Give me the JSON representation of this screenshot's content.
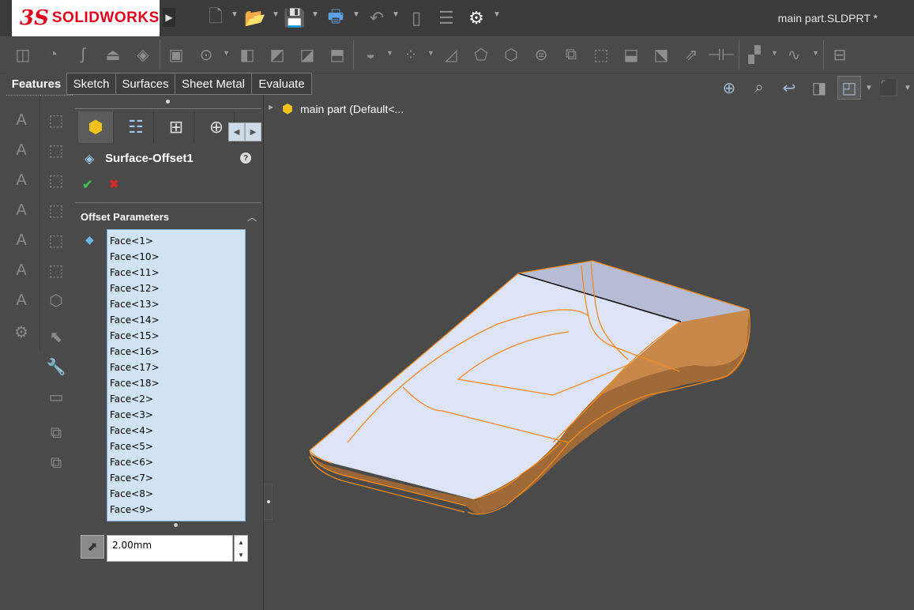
{
  "app": {
    "brand_ds": "3S",
    "brand_name": "SOLIDWORKS",
    "document_title": "main part.SLDPRT *"
  },
  "command_tabs": [
    "Features",
    "Sketch",
    "Surfaces",
    "Sheet Metal",
    "Evaluate"
  ],
  "feature_tree": {
    "root_label": "main part  (Default<..."
  },
  "property_manager": {
    "feature_name": "Surface-Offset1",
    "section_title": "Offset Parameters",
    "faces": [
      "Face<1>",
      "Face<10>",
      "Face<11>",
      "Face<12>",
      "Face<13>",
      "Face<14>",
      "Face<15>",
      "Face<16>",
      "Face<17>",
      "Face<18>",
      "Face<2>",
      "Face<3>",
      "Face<4>",
      "Face<5>",
      "Face<6>",
      "Face<7>",
      "Face<8>",
      "Face<9>"
    ],
    "offset_distance": "2.00mm"
  },
  "colors": {
    "selection_edge": "#f28a1f",
    "face_fill": "#dde4f7",
    "background": "#4a4a4a",
    "list_bg": "#d1e4f5"
  }
}
